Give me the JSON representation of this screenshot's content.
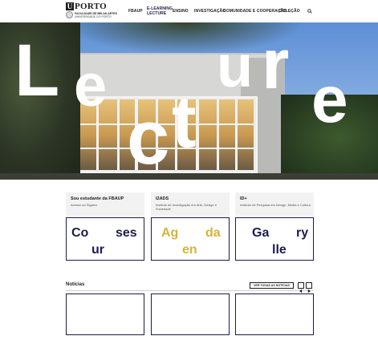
{
  "header": {
    "logo": {
      "mark": "U",
      "word": "PORTO",
      "line1": "FACULDADE DE BELAS ARTES",
      "line2": "UNIVERSIDADE DO PORTO"
    },
    "nav": [
      {
        "label": "FBAUP"
      },
      {
        "label": "E-LEARNING",
        "label2": "LECTURE"
      },
      {
        "label": "ENSINO"
      },
      {
        "label": "INVESTIGAÇÃO"
      },
      {
        "label": "COMUNIDADE E COOPERAÇÃO"
      },
      {
        "label": "COLEÇÃO"
      }
    ],
    "search_icon": "search-icon"
  },
  "hero": {
    "letters": [
      "L",
      "e",
      "c",
      "t",
      "u",
      "r",
      "e"
    ]
  },
  "info_cards": [
    {
      "title": "Sou estudante da FBAUP",
      "subtitle": "Acesso ao Sigarra"
    },
    {
      "title": "I2ADS",
      "subtitle": "Instituto de Investigação em Arte, Design e Sociedade"
    },
    {
      "title": "ID+",
      "subtitle": "Instituto de Pesquisa em Design, Média e Cultura"
    }
  ],
  "tiles": [
    {
      "parts": [
        "Co",
        "ses",
        "ur"
      ],
      "color": "#1e1b4b"
    },
    {
      "parts": [
        "Ag",
        "da",
        "en"
      ],
      "color": "#d4b43a"
    },
    {
      "parts": [
        "Ga",
        "ry",
        "lle"
      ],
      "color": "#1e1b4b"
    }
  ],
  "news": {
    "title": "Notícias",
    "see_all": "VER TODAS AS NOTÍCIAS",
    "prev_icon": "chevron-left-icon",
    "next_icon": "chevron-right-icon"
  },
  "colors": {
    "navy": "#1e1b4b",
    "gold": "#d4b43a"
  }
}
